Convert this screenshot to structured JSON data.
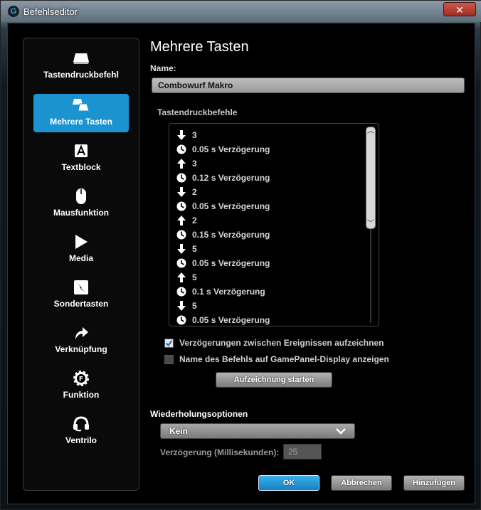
{
  "window": {
    "title": "Befehlseditor",
    "close_glyph": "✕",
    "app_icon_glyph": "G"
  },
  "sidebar": {
    "items": [
      {
        "label": "Tastendruckbefehl",
        "icon": "key-icon",
        "active": false
      },
      {
        "label": "Mehrere Tasten",
        "icon": "multi-key-icon",
        "active": true
      },
      {
        "label": "Textblock",
        "icon": "text-block-icon",
        "active": false
      },
      {
        "label": "Mausfunktion",
        "icon": "mouse-icon",
        "active": false
      },
      {
        "label": "Media",
        "icon": "play-icon",
        "active": false
      },
      {
        "label": "Sondertasten",
        "icon": "special-key-icon",
        "active": false
      },
      {
        "label": "Verknüpfung",
        "icon": "shortcut-arrow-icon",
        "active": false
      },
      {
        "label": "Funktion",
        "icon": "function-gear-icon",
        "active": false
      },
      {
        "label": "Ventrilo",
        "icon": "headset-icon",
        "active": false
      }
    ]
  },
  "main": {
    "heading": "Mehrere Tasten",
    "name_label": "Name:",
    "name_value": "Combowurf Makro",
    "list_label": "Tastendruckbefehle",
    "events": [
      {
        "type": "down",
        "text": "3"
      },
      {
        "type": "delay",
        "text": "0.05 s Verzögerung"
      },
      {
        "type": "up",
        "text": "3"
      },
      {
        "type": "delay",
        "text": "0.12 s Verzögerung"
      },
      {
        "type": "down",
        "text": "2"
      },
      {
        "type": "delay",
        "text": "0.05 s Verzögerung"
      },
      {
        "type": "up",
        "text": "2"
      },
      {
        "type": "delay",
        "text": "0.15 s Verzögerung"
      },
      {
        "type": "down",
        "text": "5"
      },
      {
        "type": "delay",
        "text": "0.05 s Verzögerung"
      },
      {
        "type": "up",
        "text": "5"
      },
      {
        "type": "delay",
        "text": "0.1 s Verzögerung"
      },
      {
        "type": "down",
        "text": "5"
      },
      {
        "type": "delay",
        "text": "0.05 s Verzögerung"
      }
    ],
    "checkbox_record_delays": {
      "label": "Verzögerungen zwischen Ereignissen aufzeichnen",
      "checked": true
    },
    "checkbox_gamepanel": {
      "label": "Name des Befehls auf GamePanel-Display anzeigen",
      "checked": false
    },
    "record_button": "Aufzeichnung starten",
    "repeat_label": "Wiederholungsoptionen",
    "repeat_selected": "Kein",
    "delay_label": "Verzögerung (Millisekunden):",
    "delay_value": "25",
    "buttons": {
      "ok": "OK",
      "cancel": "Abbrechen",
      "add": "Hinzufügen"
    }
  },
  "colors": {
    "accent": "#1a93d0",
    "background": "#000000",
    "button_gray": "#9a9a9a"
  }
}
